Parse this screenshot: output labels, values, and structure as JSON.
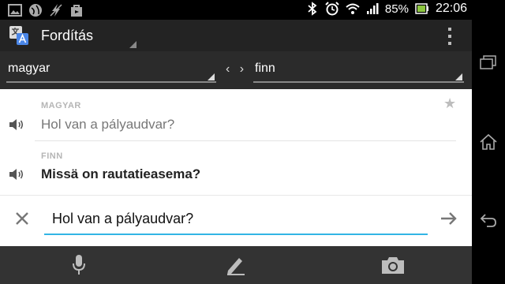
{
  "status_bar": {
    "battery_percent": "85%",
    "time": "22:06",
    "icons": [
      "image-icon",
      "globe-icon",
      "flash-off-icon",
      "bag-icon",
      "bluetooth-icon",
      "alarm-icon",
      "wifi-icon",
      "signal-icon",
      "battery-icon"
    ]
  },
  "action_bar": {
    "title": "Fordítás",
    "icons": [
      "translate-app-icon",
      "overflow-menu-icon"
    ]
  },
  "languages": {
    "source": "magyar",
    "target": "finn",
    "swap_glyph": "‹ ›"
  },
  "translation": {
    "source_label": "MAGYAR",
    "source_text": "Hol van a pályaudvar?",
    "target_label": "FINN",
    "target_text": "Missä on rautatieasema?"
  },
  "input": {
    "value": "Hol van a pályaudvar?"
  },
  "bottom_bar": {
    "icons": [
      "microphone-icon",
      "handwriting-pen-icon",
      "camera-icon"
    ]
  },
  "colors": {
    "accent": "#32b5e5",
    "input_text": "#111111",
    "label_gray": "#b5b5b5"
  }
}
